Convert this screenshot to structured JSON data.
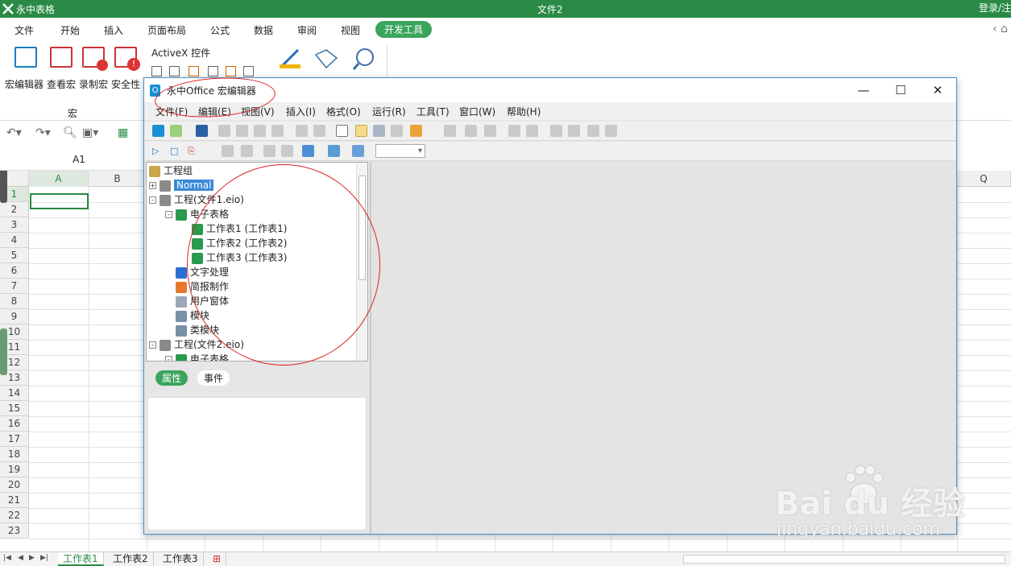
{
  "app": {
    "name": "永中表格",
    "document_title": "文件2",
    "login_label": "登录/注",
    "accent_color": "#2a8a45"
  },
  "menu": [
    "文件",
    "开始",
    "插入",
    "页面布局",
    "公式",
    "数据",
    "审阅",
    "视图",
    "开发工具"
  ],
  "menu_active": "开发工具",
  "ribbon": {
    "macro_buttons": [
      "宏编辑器",
      "查看宏",
      "录制宏",
      "安全性"
    ],
    "macro_group_label": "宏",
    "activex_label": "ActiveX 控件"
  },
  "name_box": "A1",
  "columns": [
    "A",
    "B",
    "Q"
  ],
  "rows": [
    "1",
    "2",
    "3",
    "4",
    "5",
    "6",
    "7",
    "8",
    "9",
    "10",
    "11",
    "12",
    "13",
    "14",
    "15",
    "16",
    "17",
    "18",
    "19",
    "20",
    "21",
    "22",
    "23"
  ],
  "sheet_tabs": [
    "工作表1",
    "工作表2",
    "工作表3"
  ],
  "active_sheet": "工作表1",
  "macro_editor": {
    "title": "永中Office 宏编辑器",
    "menu": [
      "文件(F)",
      "编辑(E)",
      "视图(V)",
      "插入(I)",
      "格式(O)",
      "运行(R)",
      "工具(T)",
      "窗口(W)",
      "帮助(H)"
    ],
    "tree": [
      {
        "label": "工程组",
        "icon": "project-group-icon",
        "level": 0,
        "expander": ""
      },
      {
        "label": "Normal",
        "icon": "project-icon",
        "level": 0,
        "expander": "+",
        "selected": true
      },
      {
        "label": "工程(文件1.eio)",
        "icon": "project-icon",
        "level": 0,
        "expander": "-"
      },
      {
        "label": "电子表格",
        "icon": "spreadsheet-icon",
        "level": 1,
        "expander": "-"
      },
      {
        "label": "工作表1 (工作表1)",
        "icon": "spreadsheet-icon",
        "level": 2,
        "expander": ""
      },
      {
        "label": "工作表2 (工作表2)",
        "icon": "spreadsheet-icon",
        "level": 2,
        "expander": ""
      },
      {
        "label": "工作表3 (工作表3)",
        "icon": "spreadsheet-icon",
        "level": 2,
        "expander": ""
      },
      {
        "label": "文字处理",
        "icon": "word-icon",
        "level": 1,
        "expander": ""
      },
      {
        "label": "简报制作",
        "icon": "presentation-icon",
        "level": 1,
        "expander": ""
      },
      {
        "label": "用户窗体",
        "icon": "userform-icon",
        "level": 1,
        "expander": ""
      },
      {
        "label": "模块",
        "icon": "module-icon",
        "level": 1,
        "expander": ""
      },
      {
        "label": "类模块",
        "icon": "class-module-icon",
        "level": 1,
        "expander": ""
      },
      {
        "label": "工程(文件2.eio)",
        "icon": "project-icon",
        "level": 0,
        "expander": "-"
      },
      {
        "label": "电子表格",
        "icon": "spreadsheet-icon",
        "level": 1,
        "expander": "-"
      }
    ],
    "property_tabs": [
      "属性",
      "事件"
    ],
    "property_tab_active": "属性"
  },
  "watermark": {
    "brand": "Bai du 经验",
    "url": "jingyan.baidu.com"
  }
}
